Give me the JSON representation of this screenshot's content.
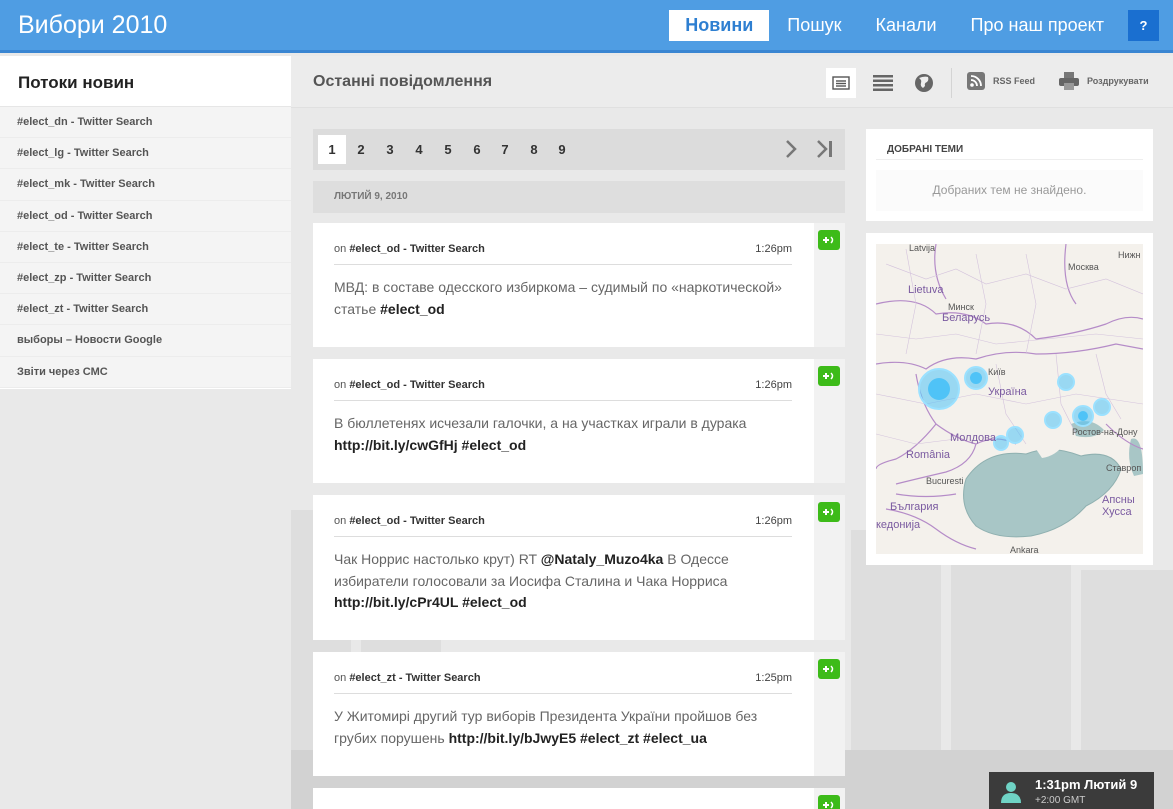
{
  "header": {
    "brand": "Вибори 2010",
    "nav": [
      "Новини",
      "Пошук",
      "Канали",
      "Про наш проект"
    ],
    "help": "?"
  },
  "sidebar": {
    "title": "Потоки новин",
    "items": [
      "#elect_dn - Twitter Search",
      "#elect_lg - Twitter Search",
      "#elect_mk - Twitter Search",
      "#elect_od - Twitter Search",
      "#elect_te - Twitter Search",
      "#elect_zp - Twitter Search",
      "#elect_zt - Twitter Search",
      "выборы – Новости Google",
      "Звіти через СМС"
    ]
  },
  "main": {
    "title": "Останні повідомлення",
    "rss_label": "RSS Feed",
    "print_label": "Роздрукувати"
  },
  "pager": {
    "pages": [
      "1",
      "2",
      "3",
      "4",
      "5",
      "6",
      "7",
      "8",
      "9"
    ],
    "current": "1"
  },
  "date_header": "ЛЮТИЙ 9, 2010",
  "posts": [
    {
      "on": "on",
      "source": "#elect_od - Twitter Search",
      "time": "1:26pm",
      "text_plain": "МВД: в составе одесского избиркома – судимый по «наркотической» статье",
      "text_bold": "#elect_od"
    },
    {
      "on": "on",
      "source": "#elect_od - Twitter Search",
      "time": "1:26pm",
      "text_plain": "В бюллетенях исчезали галочки, а на участках играли в дурака",
      "text_bold": "http://bit.ly/cwGfHj #elect_od"
    },
    {
      "on": "on",
      "source": "#elect_od - Twitter Search",
      "time": "1:26pm",
      "text_plain_1": "Чак Норрис настолько крут) RT",
      "text_bold_1": "@Nataly_Muzo4ka",
      "text_plain_2": "В Одессе избиратели голосовали за Иосифа Сталина и Чака Норриса",
      "text_bold_2": "http://bit.ly/cPr4UL #elect_od"
    },
    {
      "on": "on",
      "source": "#elect_zt - Twitter Search",
      "time": "1:25pm",
      "text_plain": "У Житомирі другий тур виборів Президента України пройшов без грубих порушень",
      "text_bold": "http://bit.ly/bJwyE5 #elect_zt #elect_ua"
    }
  ],
  "favorites": {
    "title": "ДОБРАНІ ТЕМИ",
    "empty": "Добраних тем не знайдено."
  },
  "map": {
    "labels": [
      "Latvija",
      "Москва",
      "Нижн",
      "Lietuva",
      "Минск",
      "Беларусь",
      "Київ",
      "Україна",
      "Ростов-на-Дону",
      "Молдова",
      "Ставроп",
      "România",
      "Bucuresti",
      "Aпсны",
      "Хусса",
      "Бълrария",
      "кедонија",
      "Ankara"
    ]
  },
  "clock": {
    "time": "1:31pm Лютий 9",
    "zone": "+2:00 GMT"
  },
  "colors": {
    "header": "#4f9de3",
    "accent": "#2e7fd1",
    "add": "#3dbb19"
  }
}
